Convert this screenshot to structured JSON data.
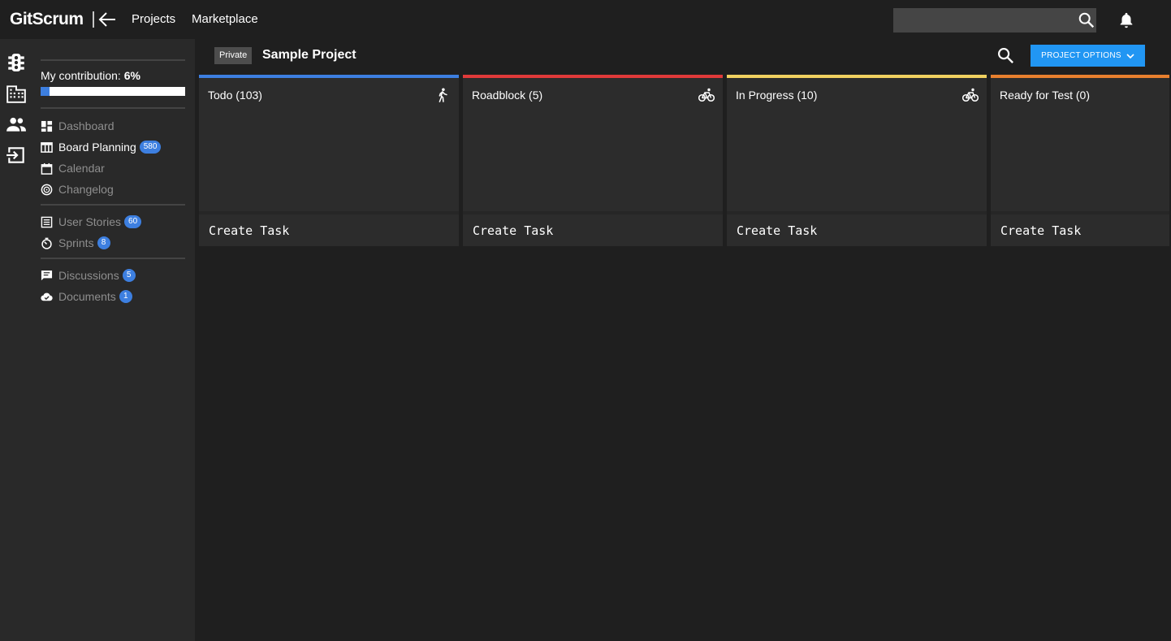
{
  "app": {
    "logo": "GitScrum",
    "nav": [
      {
        "label": "Projects"
      },
      {
        "label": "Marketplace"
      }
    ],
    "search": {
      "value": "",
      "placeholder": ""
    }
  },
  "rail": {
    "icons": [
      "traffic-light-icon",
      "building-icon",
      "people-icon",
      "exit-icon"
    ]
  },
  "sidebar": {
    "contribution_label": "My contribution: ",
    "contribution_value": "6%",
    "contribution_fraction": 0.06,
    "items": [
      {
        "label": "Dashboard",
        "icon": "dashboard-icon",
        "active": false,
        "badge": ""
      },
      {
        "label": "Board Planning",
        "icon": "board-icon",
        "active": true,
        "badge": "580"
      },
      {
        "label": "Calendar",
        "icon": "calendar-icon",
        "active": false,
        "badge": ""
      },
      {
        "label": "Changelog",
        "icon": "changelog-icon",
        "active": false,
        "badge": ""
      },
      {
        "label": "User Stories",
        "icon": "list-icon",
        "active": false,
        "badge": "60"
      },
      {
        "label": "Sprints",
        "icon": "timer-icon",
        "active": false,
        "badge": "8"
      },
      {
        "label": "Discussions",
        "icon": "chat-icon",
        "active": false,
        "badge": "5"
      },
      {
        "label": "Documents",
        "icon": "cloud-icon",
        "active": false,
        "badge": "1"
      }
    ]
  },
  "project": {
    "visibility": "Private",
    "title": "Sample Project",
    "options_label": "PROJECT OPTIONS"
  },
  "columns": [
    {
      "title": "Todo (103)",
      "color": "#3d7fe0",
      "icon": "walker-icon",
      "create_label": "Create Task"
    },
    {
      "title": "Roadblock (5)",
      "color": "#e03a3a",
      "icon": "bike-icon",
      "create_label": "Create Task"
    },
    {
      "title": "In Progress (10)",
      "color": "#f0d060",
      "icon": "bike-icon",
      "create_label": "Create Task"
    },
    {
      "title": "Ready for Test (0)",
      "color": "#e8802e",
      "icon": "",
      "create_label": "Create Task"
    }
  ],
  "colors": {
    "accent": "#2196f3",
    "badge": "#3d7fe0",
    "background": "#1f1f1f",
    "sidebar": "#292929"
  }
}
